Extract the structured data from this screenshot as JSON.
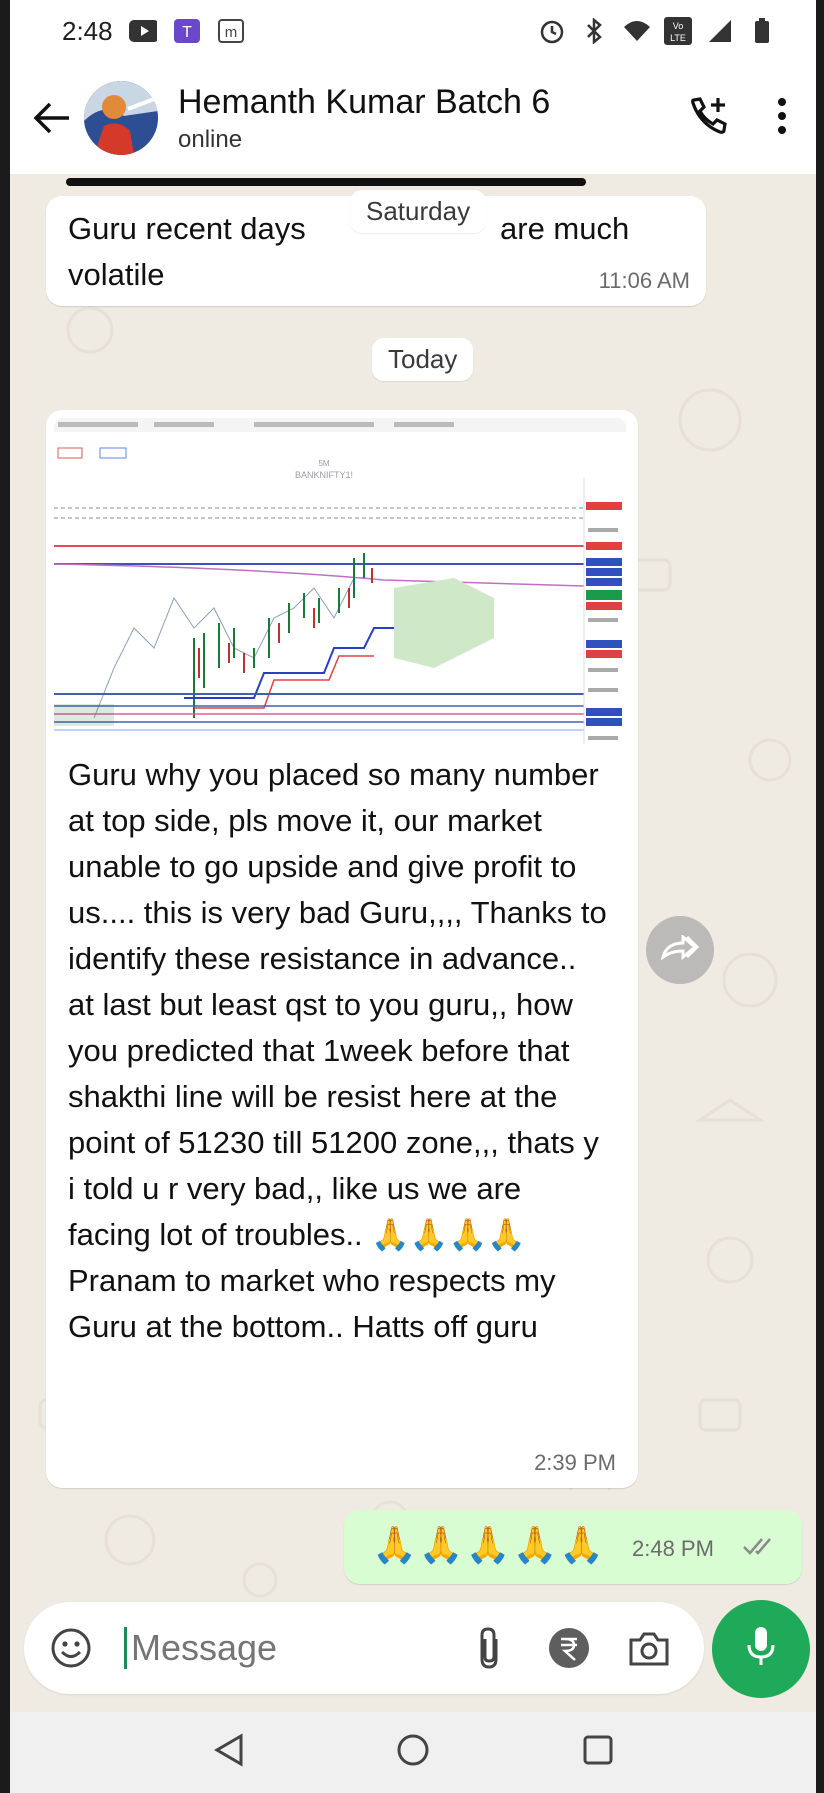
{
  "status_bar": {
    "time": "2:48",
    "left_icons": [
      "youtube-icon",
      "app-icon",
      "m-icon"
    ],
    "right_icons": [
      "alarm-icon",
      "bluetooth-icon",
      "wifi-icon",
      "volte-icon",
      "signal-icon",
      "battery-icon"
    ],
    "volte_label": "Vo LTE"
  },
  "header": {
    "name": "Hemanth Kumar Batch 6",
    "status": "online",
    "call_icon": "add-call-icon",
    "menu_icon": "more-vert-icon"
  },
  "chat": {
    "floating_date": "Saturday",
    "msg1": {
      "text_part1": "Guru recent days",
      "text_part2": "are much",
      "text_part3": "volatile",
      "time": "11:06 AM"
    },
    "today_label": "Today",
    "msg2": {
      "chart_title": "BANKNIFTY1!",
      "chart_sub": "5M",
      "text": "Guru why you placed so many number at top side, pls move it, our market unable to go upside and give profit to us.... this is very bad Guru,,,, Thanks to identify these resistance in advance.. at last but least qst to you guru,, how you predicted that 1week before that shakthi line will be resist here at the point of 51230 till 51200 zone,,, thats y i told u r very bad,, like us we are facing lot of troubles.. 🙏🙏🙏🙏 Pranam to market who respects my Guru at the bottom.. Hatts off guru",
      "time": "2:39 PM"
    },
    "msg3": {
      "text": "🙏🙏🙏🙏🙏",
      "time": "2:48 PM",
      "status": "read"
    }
  },
  "composer": {
    "placeholder": "Message",
    "icons": [
      "emoji-icon",
      "attach-icon",
      "rupee-icon",
      "camera-icon"
    ],
    "mic_icon": "mic-icon"
  },
  "colors": {
    "background": "#efeae2",
    "outgoing_bubble": "#d9fdd3",
    "mic_button": "#1faa59",
    "read_ticks": "#8a8a8a"
  }
}
